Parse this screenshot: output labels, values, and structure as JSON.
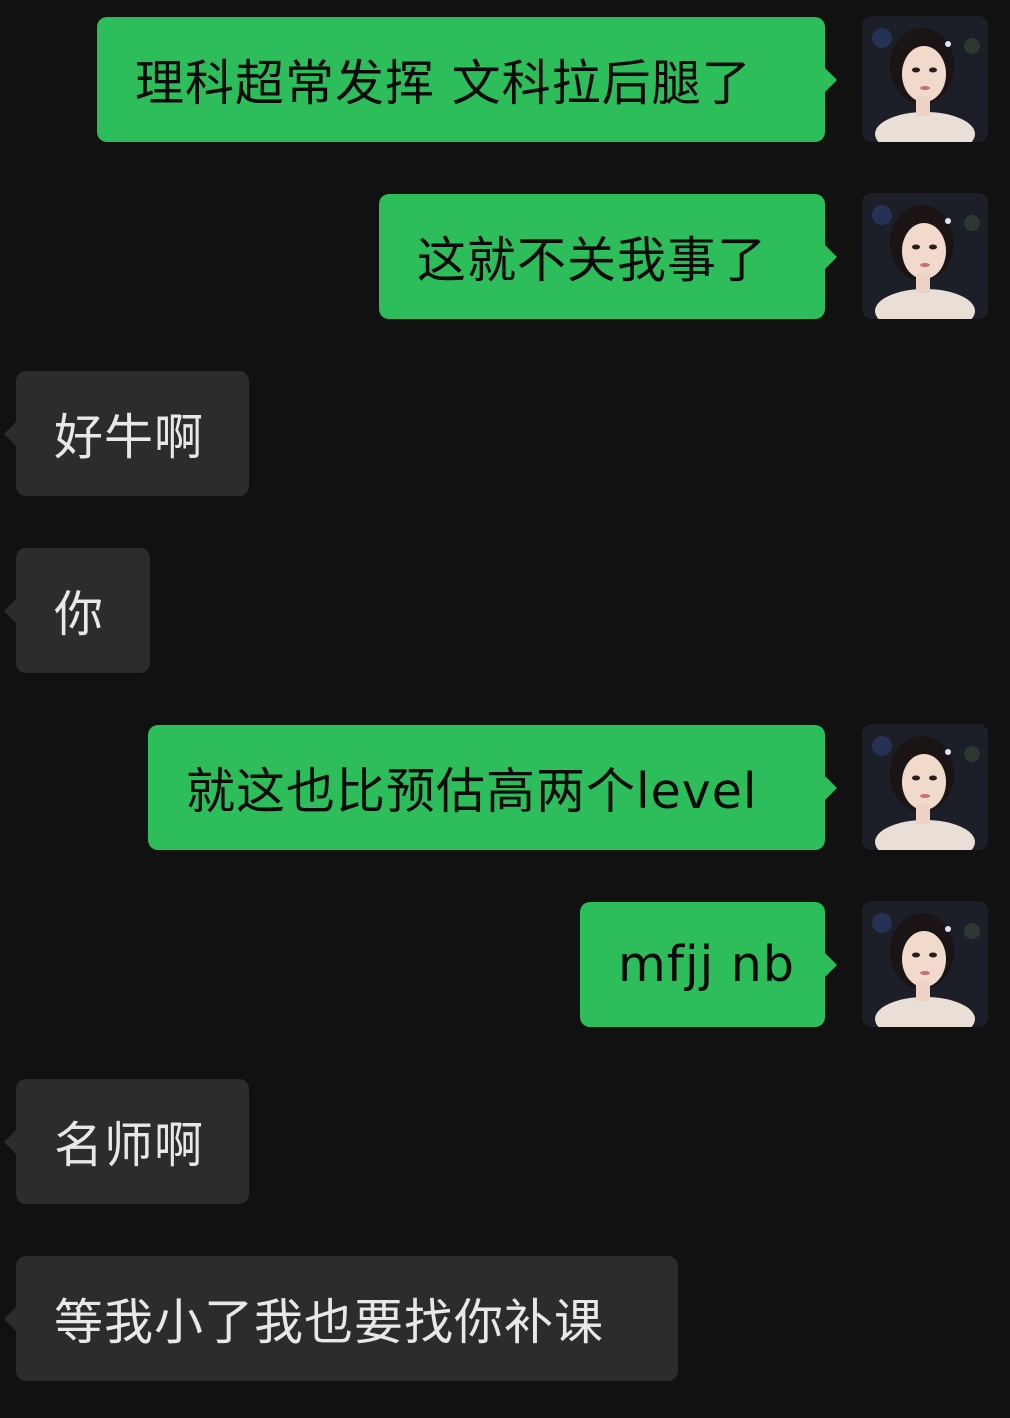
{
  "colors": {
    "background": "#111111",
    "outgoing_bubble": "#2dbd5b",
    "incoming_bubble": "#2c2c2c",
    "outgoing_text": "#0a0a0a",
    "incoming_text": "#e8e8e8"
  },
  "messages": [
    {
      "direction": "outgoing",
      "text": "理科超常发挥 文科拉后腿了",
      "avatar_icon": "portrait-avatar-icon"
    },
    {
      "direction": "outgoing",
      "text": "这就不关我事了",
      "avatar_icon": "portrait-avatar-icon"
    },
    {
      "direction": "incoming",
      "text": "好牛啊"
    },
    {
      "direction": "incoming",
      "text": "你"
    },
    {
      "direction": "outgoing",
      "text": "就这也比预估高两个level",
      "avatar_icon": "portrait-avatar-icon"
    },
    {
      "direction": "outgoing",
      "text": "mfjj nb",
      "avatar_icon": "portrait-avatar-icon"
    },
    {
      "direction": "incoming",
      "text": "名师啊"
    },
    {
      "direction": "incoming",
      "text": "等我小了我也要找你补课"
    }
  ]
}
